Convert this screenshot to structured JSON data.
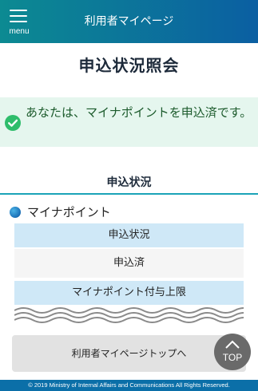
{
  "header": {
    "menu_label": "menu",
    "title": "利用者マイページ"
  },
  "page": {
    "title": "申込状況照会"
  },
  "notice": {
    "text": "あなたは、マイナポイントを申込済です。"
  },
  "section": {
    "title": "申込状況",
    "subsection_label": "マイナポイント",
    "rows": [
      {
        "label": "申込状況",
        "value": "申込済"
      },
      {
        "label": "マイナポイント付与上限"
      }
    ]
  },
  "actions": {
    "mypage_top_label": "利用者マイページトップへ",
    "top_label": "TOP"
  },
  "footer": {
    "copyright": "© 2019 Ministry of Internal Affairs and Communications All Rights Reserved."
  },
  "colors": {
    "header_start": "#0c8a92",
    "header_end": "#0b5fa2",
    "notice_bg": "#e5f6ee",
    "check_green": "#2ebd6b",
    "table_head": "#cfe8f7",
    "footer_bg": "#0b6fa8"
  },
  "icons": [
    "menu-icon",
    "check-circle-icon",
    "bullet-dot-icon",
    "chevron-up-icon"
  ]
}
